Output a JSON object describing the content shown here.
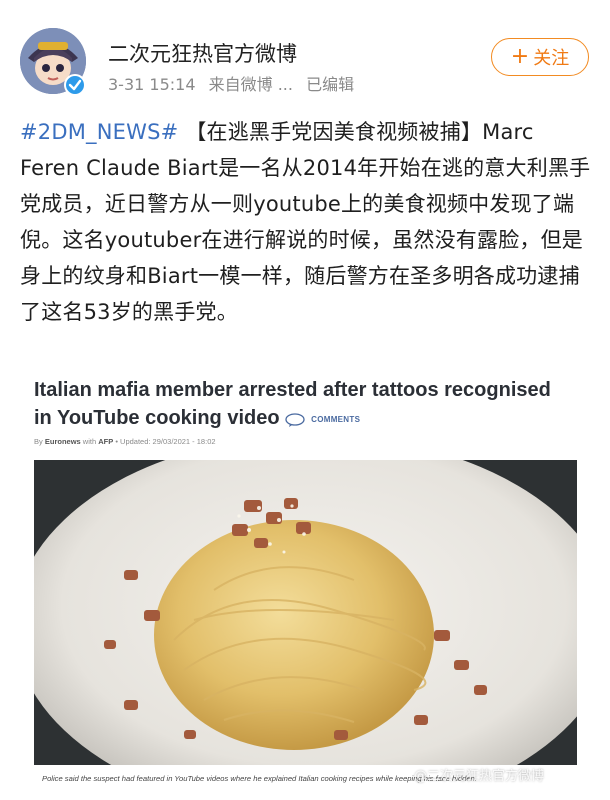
{
  "user": {
    "name": "二次元狂热官方微博",
    "time": "3-31 15:14",
    "source": "来自微博 ...",
    "edited": "已编辑"
  },
  "follow": {
    "label": "关注",
    "icon": "plus-icon"
  },
  "post": {
    "hashtag": "#2DM_NEWS#",
    "headline": "【在逃黑手党因美食视频被捕】",
    "body": "Marc Feren Claude Biart是一名从2014年开始在逃的意大利黑手党成员，近日警方从一则youtube上的美食视频中发现了端倪。这名youtuber在进行解说的时候，虽然没有露脸，但是身上的纹身和Biart一模一样，随后警方在圣多明各成功逮捕了这名53岁的黑手党。"
  },
  "article": {
    "title": "Italian mafia member arrested after tattoos recognised in YouTube cooking video",
    "comments_label": "COMMENTS",
    "by_prefix": "By",
    "source": "Euronews",
    "with": "with",
    "agency": "AFP",
    "updated": "• Updated: 29/03/2021 - 18:02",
    "caption": "Police said the suspect had featured in YouTube videos where he explained Italian cooking recipes while keeping his face hidden."
  },
  "watermark": "@二次元狂热官方微博",
  "colors": {
    "accent": "#f07a14",
    "link": "#3a6fbf",
    "verified": "#2e9bea"
  }
}
